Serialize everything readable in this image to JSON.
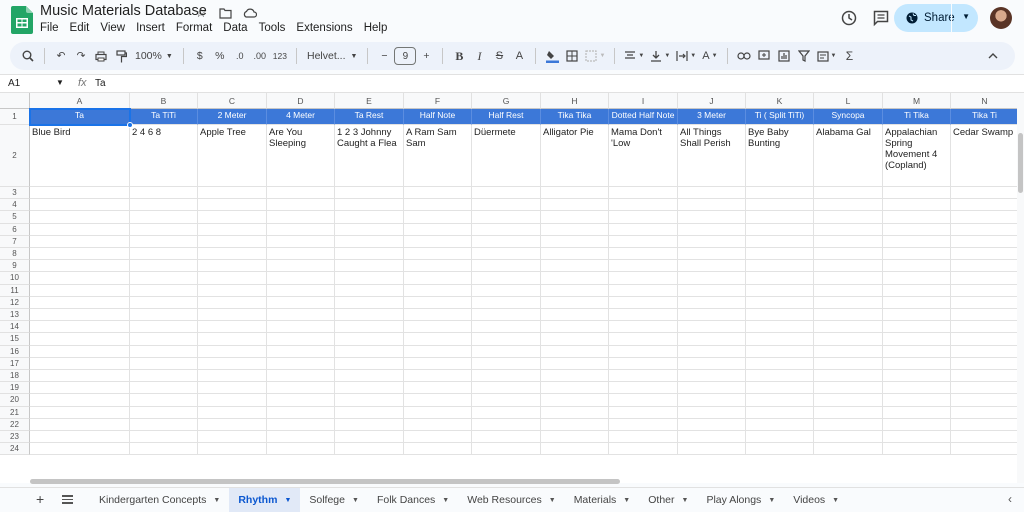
{
  "document": {
    "title": "Music Materials Database"
  },
  "menu": [
    "File",
    "Edit",
    "View",
    "Insert",
    "Format",
    "Data",
    "Tools",
    "Extensions",
    "Help"
  ],
  "share": {
    "label": "Share"
  },
  "toolbar": {
    "zoom": "100%",
    "currency": "$",
    "percent": "%",
    "dec_decrease": ".0",
    "dec_increase": ".00",
    "number_format": "123",
    "font": "Helvet...",
    "font_size": "9"
  },
  "formula_bar": {
    "cell_ref": "A1",
    "fx": "fx",
    "value": "Ta"
  },
  "columns": [
    "A",
    "B",
    "C",
    "D",
    "E",
    "F",
    "G",
    "H",
    "I",
    "J",
    "K",
    "L",
    "M",
    "N"
  ],
  "row_numbers": [
    "1",
    "2",
    "3",
    "4",
    "5",
    "6",
    "7",
    "8",
    "9",
    "10",
    "11",
    "12",
    "13",
    "14",
    "15",
    "16",
    "17",
    "18",
    "19",
    "20",
    "21",
    "22",
    "23",
    "24"
  ],
  "header_row": [
    "Ta",
    "Ta TiTi",
    "2 Meter",
    "4 Meter",
    "Ta Rest",
    "Half Note",
    "Half Rest",
    "Tika Tika",
    "Dotted Half Note",
    "3 Meter",
    "Ti ( Split TiTi)",
    "Syncopa",
    "Ti Tika",
    "Tika Ti"
  ],
  "data_row": [
    "Blue Bird",
    "2 4 6 8",
    "Apple Tree",
    "Are You Sleeping",
    "1 2 3 Johnny Caught a Flea",
    "A Ram Sam Sam",
    "Düermete",
    "Alligator Pie",
    "Mama Don't 'Low",
    "All Things Shall Perish",
    "Bye Baby Bunting",
    "Alabama Gal",
    "Appalachian Spring Movement 4 (Copland)",
    "Cedar Swamp"
  ],
  "sheet_tabs": [
    {
      "label": "Kindergarten Concepts",
      "active": false
    },
    {
      "label": "Rhythm",
      "active": true
    },
    {
      "label": "Solfege",
      "active": false
    },
    {
      "label": "Folk Dances",
      "active": false
    },
    {
      "label": "Web Resources",
      "active": false
    },
    {
      "label": "Materials",
      "active": false
    },
    {
      "label": "Other",
      "active": false
    },
    {
      "label": "Play Alongs",
      "active": false
    },
    {
      "label": "Videos",
      "active": false
    }
  ],
  "colors": {
    "header_fill": "#3c78d8",
    "accent": "#1a73e8",
    "share_bg": "#c2e7ff"
  }
}
